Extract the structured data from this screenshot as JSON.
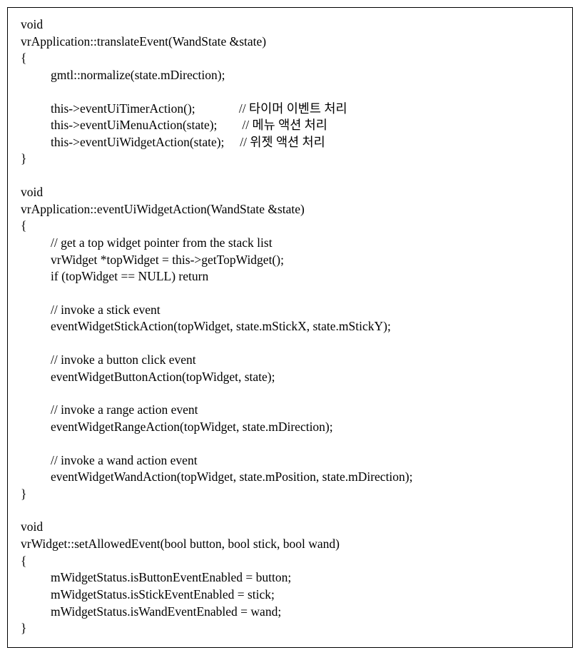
{
  "code": {
    "lines": [
      {
        "text": "void",
        "indent": 0
      },
      {
        "text": "vrApplication::translateEvent(WandState &state)",
        "indent": 0
      },
      {
        "text": "{",
        "indent": 0
      },
      {
        "text": "gmtl::normalize(state.mDirection);",
        "indent": 1
      },
      {
        "text": "",
        "indent": 0,
        "blank": true
      },
      {
        "text": "this->eventUiTimerAction();              // 타이머 이벤트 처리",
        "indent": 1
      },
      {
        "text": "this->eventUiMenuAction(state);        // 메뉴 액션 처리",
        "indent": 1
      },
      {
        "text": "this->eventUiWidgetAction(state);     // 위젯 액션 처리",
        "indent": 1
      },
      {
        "text": "}",
        "indent": 0
      },
      {
        "text": "",
        "indent": 0,
        "blank": true
      },
      {
        "text": "void",
        "indent": 0
      },
      {
        "text": "vrApplication::eventUiWidgetAction(WandState &state)",
        "indent": 0
      },
      {
        "text": "{",
        "indent": 0
      },
      {
        "text": "// get a top widget pointer from the stack list",
        "indent": 1
      },
      {
        "text": "vrWidget *topWidget = this->getTopWidget();",
        "indent": 1
      },
      {
        "text": "if (topWidget == NULL) return",
        "indent": 1
      },
      {
        "text": "",
        "indent": 0,
        "blank": true
      },
      {
        "text": "// invoke a stick event",
        "indent": 1
      },
      {
        "text": "eventWidgetStickAction(topWidget, state.mStickX, state.mStickY);",
        "indent": 1
      },
      {
        "text": "",
        "indent": 0,
        "blank": true
      },
      {
        "text": "// invoke a button click event",
        "indent": 1
      },
      {
        "text": "eventWidgetButtonAction(topWidget, state);",
        "indent": 1
      },
      {
        "text": "",
        "indent": 0,
        "blank": true
      },
      {
        "text": "// invoke a range action event",
        "indent": 1
      },
      {
        "text": "eventWidgetRangeAction(topWidget, state.mDirection);",
        "indent": 1
      },
      {
        "text": "",
        "indent": 0,
        "blank": true
      },
      {
        "text": "// invoke a wand action event",
        "indent": 1
      },
      {
        "text": "eventWidgetWandAction(topWidget, state.mPosition, state.mDirection);",
        "indent": 1
      },
      {
        "text": "}",
        "indent": 0
      },
      {
        "text": "",
        "indent": 0,
        "blank": true
      },
      {
        "text": "void",
        "indent": 0
      },
      {
        "text": "vrWidget::setAllowedEvent(bool button, bool stick, bool wand)",
        "indent": 0
      },
      {
        "text": "{",
        "indent": 0
      },
      {
        "text": "mWidgetStatus.isButtonEventEnabled = button;",
        "indent": 1
      },
      {
        "text": "mWidgetStatus.isStickEventEnabled = stick;",
        "indent": 1
      },
      {
        "text": "mWidgetStatus.isWandEventEnabled = wand;",
        "indent": 1
      },
      {
        "text": "}",
        "indent": 0
      }
    ]
  }
}
